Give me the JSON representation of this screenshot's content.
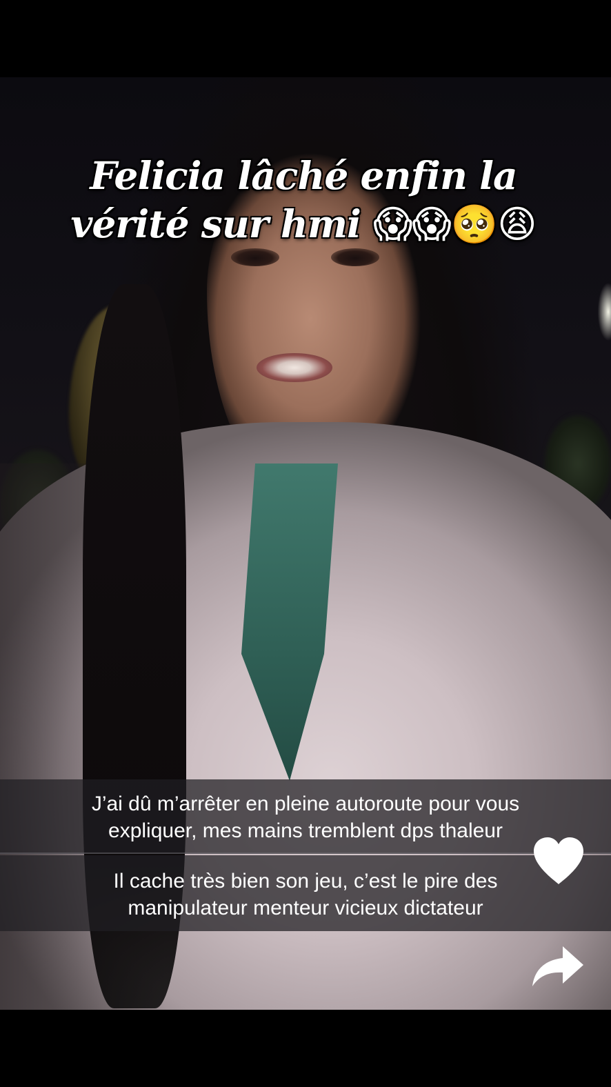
{
  "overlay": {
    "title_line1": "Felicia lâché enfin la",
    "title_line2": "vérité sur hmi",
    "title_emojis": "😱😱🥺😩"
  },
  "subtitles": {
    "block1_line1": "J’ai dû m’arrêter en pleine autoroute pour vous",
    "block1_line2": "expliquer, mes mains tremblent dps thaleur",
    "block2_line1": "Il cache très bien son jeu, c’est le pire des",
    "block2_line2": "manipulateur menteur vicieux dictateur"
  },
  "actions": {
    "like_icon": "heart-icon",
    "share_icon": "share-arrow-icon"
  },
  "colors": {
    "subtitle_bg": "#201e22",
    "icon": "#ffffff",
    "letterbox": "#000000"
  }
}
